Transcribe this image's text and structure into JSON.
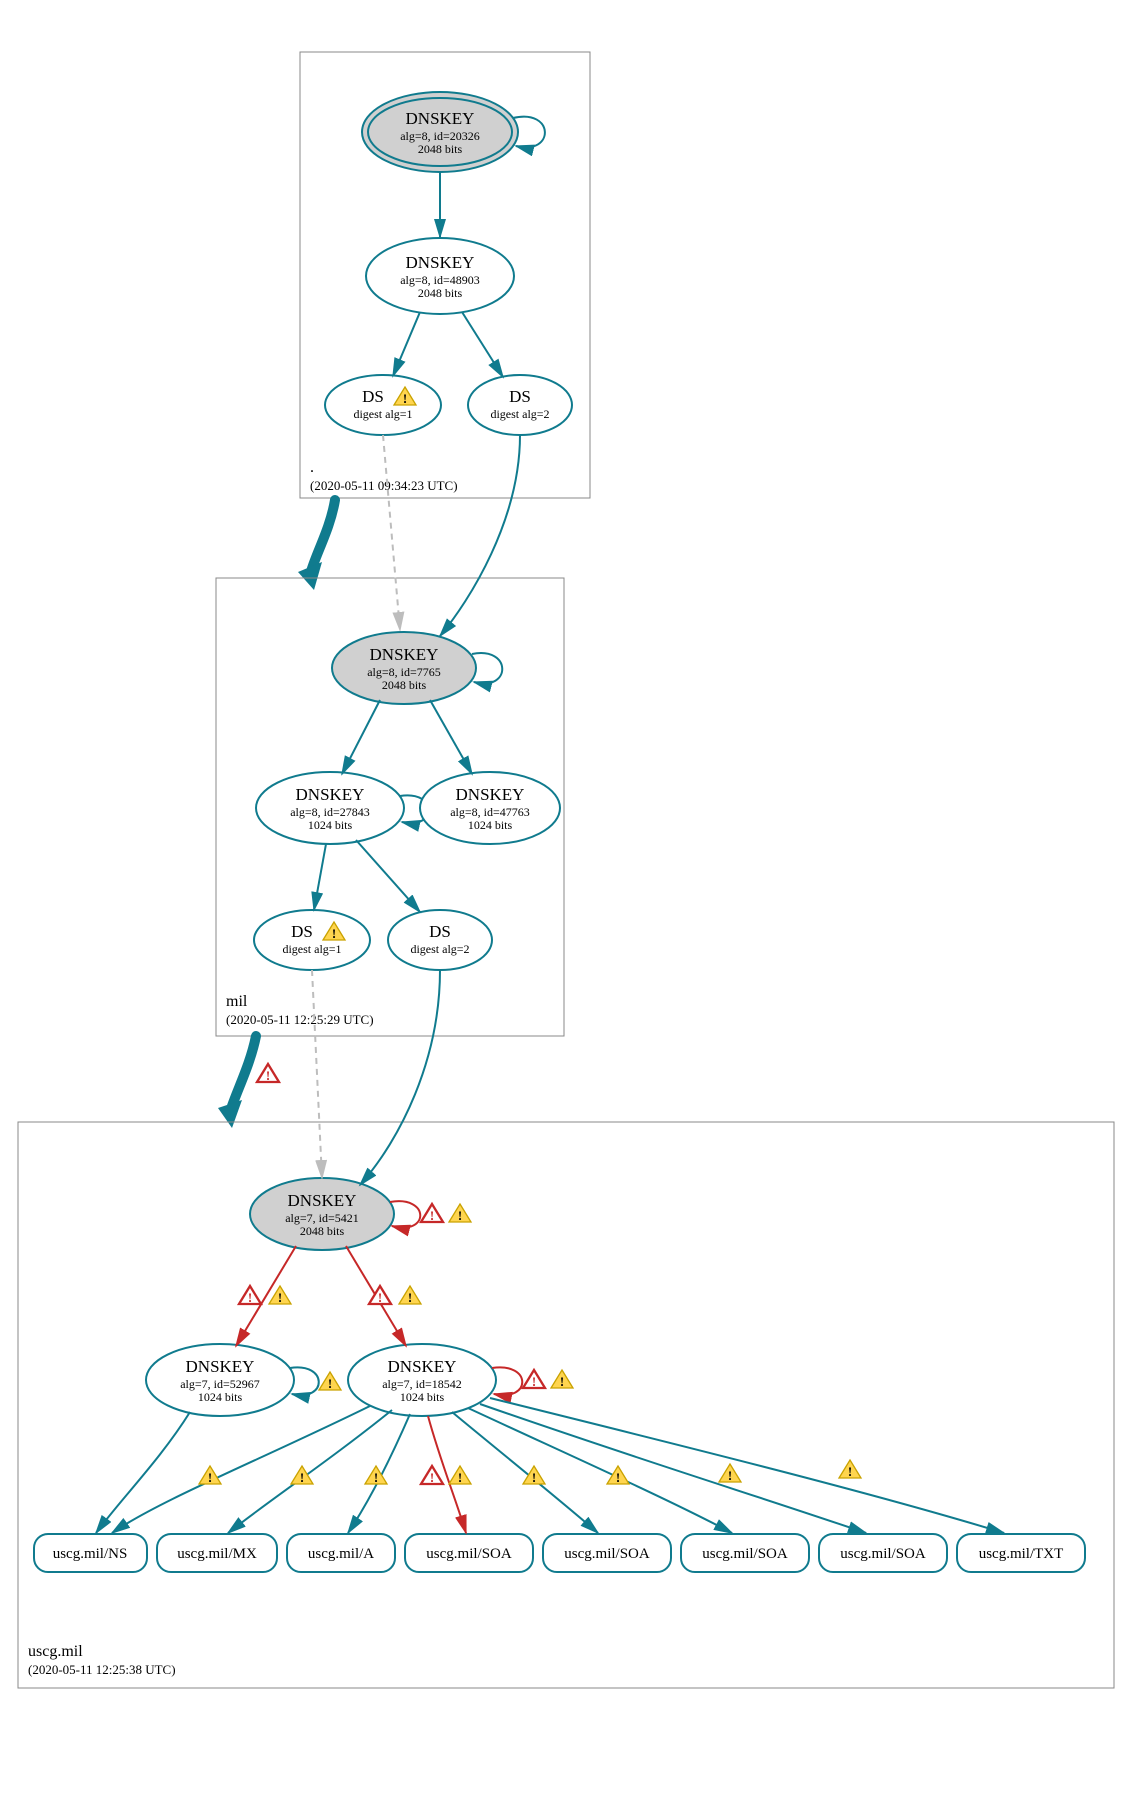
{
  "diagram": {
    "type": "dnssec-authentication-graph",
    "zones": [
      {
        "id": "root",
        "label": ".",
        "timestamp": "(2020-05-11 09:34:23 UTC)",
        "nodes": [
          {
            "id": "root-ksk",
            "type": "DNSKEY",
            "title": "DNSKEY",
            "line2": "alg=8, id=20326",
            "line3": "2048 bits",
            "trust_anchor": true,
            "self_loop": true
          },
          {
            "id": "root-zsk",
            "type": "DNSKEY",
            "title": "DNSKEY",
            "line2": "alg=8, id=48903",
            "line3": "2048 bits"
          },
          {
            "id": "root-ds1",
            "type": "DS",
            "title": "DS",
            "line2": "digest alg=1",
            "warning": true
          },
          {
            "id": "root-ds2",
            "type": "DS",
            "title": "DS",
            "line2": "digest alg=2"
          }
        ],
        "edges": [
          {
            "from": "root-ksk",
            "to": "root-ksk",
            "kind": "self"
          },
          {
            "from": "root-ksk",
            "to": "root-zsk"
          },
          {
            "from": "root-zsk",
            "to": "root-ds1"
          },
          {
            "from": "root-zsk",
            "to": "root-ds2"
          }
        ]
      },
      {
        "id": "mil",
        "label": "mil",
        "timestamp": "(2020-05-11 12:25:29 UTC)",
        "delegation_warning": false,
        "nodes": [
          {
            "id": "mil-ksk",
            "type": "DNSKEY",
            "title": "DNSKEY",
            "line2": "alg=8, id=7765",
            "line3": "2048 bits",
            "grey": true,
            "self_loop": true
          },
          {
            "id": "mil-zsk1",
            "type": "DNSKEY",
            "title": "DNSKEY",
            "line2": "alg=8, id=27843",
            "line3": "1024 bits",
            "self_loop": true
          },
          {
            "id": "mil-zsk2",
            "type": "DNSKEY",
            "title": "DNSKEY",
            "line2": "alg=8, id=47763",
            "line3": "1024 bits"
          },
          {
            "id": "mil-ds1",
            "type": "DS",
            "title": "DS",
            "line2": "digest alg=1",
            "warning": true
          },
          {
            "id": "mil-ds2",
            "type": "DS",
            "title": "DS",
            "line2": "digest alg=2"
          }
        ],
        "edges": [
          {
            "from": "root-ds1",
            "to": "mil-ksk",
            "style": "grey-dashed"
          },
          {
            "from": "root-ds2",
            "to": "mil-ksk"
          },
          {
            "from": "mil-ksk",
            "to": "mil-ksk",
            "kind": "self"
          },
          {
            "from": "mil-ksk",
            "to": "mil-zsk1"
          },
          {
            "from": "mil-ksk",
            "to": "mil-zsk2"
          },
          {
            "from": "mil-zsk1",
            "to": "mil-zsk1",
            "kind": "self"
          },
          {
            "from": "mil-zsk1",
            "to": "mil-ds1"
          },
          {
            "from": "mil-zsk1",
            "to": "mil-ds2"
          }
        ]
      },
      {
        "id": "uscg",
        "label": "uscg.mil",
        "timestamp": "(2020-05-11 12:25:38 UTC)",
        "delegation_warning": true,
        "nodes": [
          {
            "id": "uscg-ksk",
            "type": "DNSKEY",
            "title": "DNSKEY",
            "line2": "alg=7, id=5421",
            "line3": "2048 bits",
            "grey": true,
            "self_loop": true,
            "loop_badges": [
              "error",
              "warning"
            ]
          },
          {
            "id": "uscg-zsk1",
            "type": "DNSKEY",
            "title": "DNSKEY",
            "line2": "alg=7, id=52967",
            "line3": "1024 bits",
            "self_loop": true,
            "loop_badges": [
              "warning"
            ]
          },
          {
            "id": "uscg-zsk2",
            "type": "DNSKEY",
            "title": "DNSKEY",
            "line2": "alg=7, id=18542",
            "line3": "1024 bits",
            "self_loop": true,
            "loop_badges": [
              "error",
              "warning"
            ]
          },
          {
            "id": "rr-ns",
            "type": "RRSET",
            "title": "uscg.mil/NS"
          },
          {
            "id": "rr-mx",
            "type": "RRSET",
            "title": "uscg.mil/MX"
          },
          {
            "id": "rr-a",
            "type": "RRSET",
            "title": "uscg.mil/A"
          },
          {
            "id": "rr-soa1",
            "type": "RRSET",
            "title": "uscg.mil/SOA"
          },
          {
            "id": "rr-soa2",
            "type": "RRSET",
            "title": "uscg.mil/SOA"
          },
          {
            "id": "rr-soa3",
            "type": "RRSET",
            "title": "uscg.mil/SOA"
          },
          {
            "id": "rr-soa4",
            "type": "RRSET",
            "title": "uscg.mil/SOA"
          },
          {
            "id": "rr-txt",
            "type": "RRSET",
            "title": "uscg.mil/TXT"
          }
        ],
        "edges": [
          {
            "from": "mil-ds1",
            "to": "uscg-ksk",
            "style": "grey-dashed"
          },
          {
            "from": "mil-ds2",
            "to": "uscg-ksk"
          },
          {
            "from": "uscg-ksk",
            "to": "uscg-zsk1",
            "style": "red",
            "badges": [
              "error",
              "warning"
            ]
          },
          {
            "from": "uscg-ksk",
            "to": "uscg-zsk2",
            "style": "red",
            "badges": [
              "error",
              "warning"
            ]
          },
          {
            "from": "uscg-zsk1",
            "to": "rr-ns",
            "badges": [
              "warning"
            ]
          },
          {
            "from": "uscg-zsk2",
            "to": "rr-ns",
            "badges": [
              "warning"
            ]
          },
          {
            "from": "uscg-zsk2",
            "to": "rr-mx",
            "badges": [
              "warning"
            ]
          },
          {
            "from": "uscg-zsk2",
            "to": "rr-a",
            "badges": [
              "warning"
            ]
          },
          {
            "from": "uscg-zsk2",
            "to": "rr-soa1",
            "style": "red",
            "badges": [
              "error",
              "warning"
            ]
          },
          {
            "from": "uscg-zsk2",
            "to": "rr-soa2",
            "badges": [
              "warning"
            ]
          },
          {
            "from": "uscg-zsk2",
            "to": "rr-soa3",
            "badges": [
              "warning"
            ]
          },
          {
            "from": "uscg-zsk2",
            "to": "rr-soa4",
            "badges": [
              "warning"
            ]
          },
          {
            "from": "uscg-zsk2",
            "to": "rr-txt",
            "badges": [
              "warning"
            ]
          }
        ]
      }
    ]
  },
  "colors": {
    "teal": "#107b8e",
    "red": "#c62828",
    "grey_fill": "#d0d0d0",
    "box_stroke": "#888888"
  }
}
